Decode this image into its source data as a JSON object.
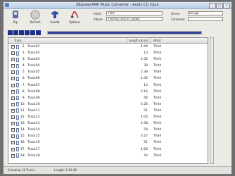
{
  "window": {
    "title": "dBpowerAMP Music Converter - Audio CD Input"
  },
  "toolbar": [
    {
      "label": "Rip",
      "icon": "rip-icon"
    },
    {
      "label": "Refresh",
      "icon": "refresh-icon"
    },
    {
      "label": "freedb",
      "icon": "freedb-icon"
    },
    {
      "label": "Options",
      "icon": "options-icon"
    }
  ],
  "meta": {
    "artist_label": "Artist",
    "artist_value": "Thhh",
    "album_label": "Album",
    "album_value": "Thoresic and Inf Sadan",
    "genre_label": "Genre",
    "genre_value": "NuGge",
    "comment_label": "Comment",
    "comment_value": ""
  },
  "progress": {
    "fraction": 1.0
  },
  "table": {
    "headers": {
      "track": "Track",
      "length": "Length (m:ss)",
      "artist": "Artist"
    },
    "rows": [
      {
        "num": "1.",
        "name": "Track01",
        "length": "4:44",
        "artist": "Thhh"
      },
      {
        "num": "2.",
        "name": "Track02",
        "length": "13",
        "artist": "Thhh"
      },
      {
        "num": "3.",
        "name": "Track03",
        "length": "4:32",
        "artist": "Thhh"
      },
      {
        "num": "4.",
        "name": "Track04",
        "length": "39",
        "artist": "Thhh"
      },
      {
        "num": "5.",
        "name": "Track05",
        "length": "2:38",
        "artist": "Thhh"
      },
      {
        "num": "6.",
        "name": "Track06",
        "length": "4:32",
        "artist": "Thhh"
      },
      {
        "num": "7.",
        "name": "Track07",
        "length": "14",
        "artist": "Thhh"
      },
      {
        "num": "8.",
        "name": "Track08",
        "length": "2:16",
        "artist": "Thhh"
      },
      {
        "num": "9.",
        "name": "Track09",
        "length": "46",
        "artist": "Thhh"
      },
      {
        "num": "10.",
        "name": "Track10",
        "length": "4:26",
        "artist": "Thhh"
      },
      {
        "num": "11.",
        "name": "Track11",
        "length": "21",
        "artist": "Thhh"
      },
      {
        "num": "12.",
        "name": "Track12",
        "length": "4:04",
        "artist": "Thhh"
      },
      {
        "num": "13.",
        "name": "Track13",
        "length": "4:38",
        "artist": "Thhh"
      },
      {
        "num": "14.",
        "name": "Track14",
        "length": "54",
        "artist": "Thhh"
      },
      {
        "num": "15.",
        "name": "Track15",
        "length": "3:27",
        "artist": "Thhh"
      },
      {
        "num": "16.",
        "name": "Track16",
        "length": "51",
        "artist": "Thhh"
      },
      {
        "num": "17.",
        "name": "Track17",
        "length": "4:28",
        "artist": "Thhh"
      },
      {
        "num": "18.",
        "name": "Track18",
        "length": "42",
        "artist": "Thhh"
      }
    ]
  },
  "status": {
    "selected": "Selecting 18 Tracks",
    "length": "Length: 1:20:48"
  },
  "colors": {
    "accent": "#1d2f86",
    "progress": "#33449a"
  }
}
